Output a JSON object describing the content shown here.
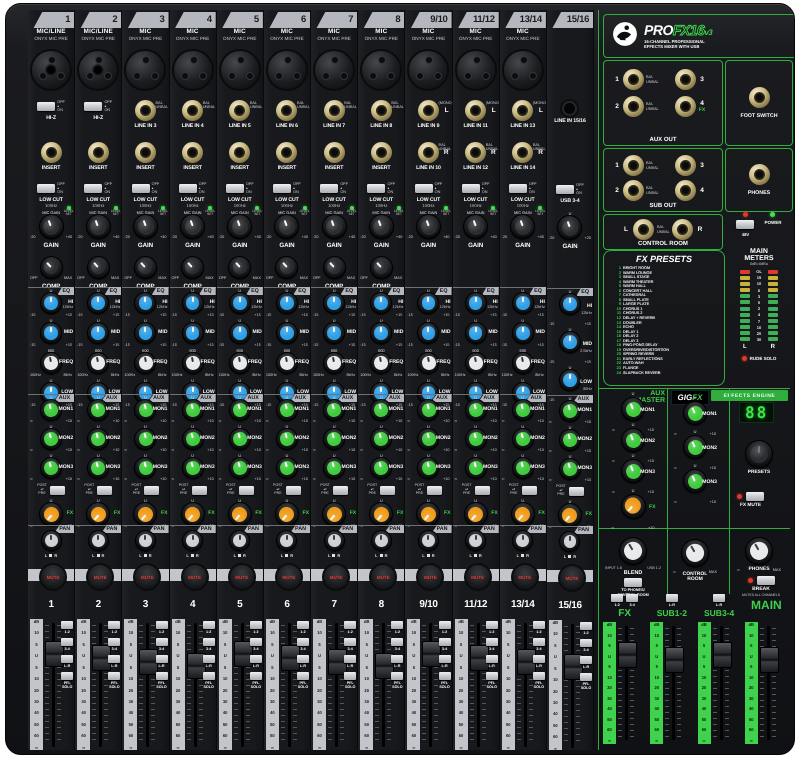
{
  "shared": {
    "u": "U",
    "inf": "∞",
    "plus10": "+10",
    "m15": "-15",
    "p15": "+15",
    "off": "OFF",
    "on": "ON",
    "post": "POST",
    "pre": "PRE",
    "max": "MAX",
    "gain": "GAIN",
    "comp": "COMP",
    "eq": "EQ",
    "aux": "AUX",
    "pan": "PAN",
    "mute": "MUTE",
    "fx": "FX",
    "l": "L",
    "r": "R",
    "mic_gain": "MIC GAIN",
    "level_set": "LEVEL SET",
    "mono": "(MONO)",
    "freq_min": "100Hz",
    "freq_max": "8kHz",
    "freq_center": "600",
    "fader_scale": [
      "dB",
      "10",
      "5",
      "U",
      "5",
      "10",
      "20",
      "30",
      "40",
      "50",
      "60",
      "∞"
    ],
    "fader_btns": [
      "1-2",
      "3-4",
      "L-R",
      "PFL SOLO"
    ],
    "eq_sweep": [
      {
        "n": "HI",
        "s": "12kHz"
      },
      {
        "n": "MID",
        "s": ""
      },
      {
        "n": "FREQ",
        "s": ""
      },
      {
        "n": "LOW",
        "s": "80Hz"
      }
    ],
    "eq_fixed": [
      {
        "n": "HI",
        "s": "12kHz"
      },
      {
        "n": "MID",
        "s": "2.5kHz"
      },
      {
        "n": "LOW",
        "s": "80Hz"
      }
    ],
    "aux_knobs": [
      "MON1",
      "MON2",
      "MON3"
    ]
  },
  "channels": [
    {
      "num": "1",
      "head": "MIC/LINE",
      "sub": "ONYX MIC PRE",
      "input": "combo",
      "rowa": {
        "type": "switch",
        "label": "HI-Z",
        "side": "",
        "tag": ""
      },
      "rowb": {
        "type": "jack",
        "label": "INSERT",
        "side": "",
        "tag": ""
      },
      "sw": {
        "l1": "LOW CUT",
        "l2": "100Hz"
      },
      "gain": {
        "top": "MIC GAIN",
        "min": "-20",
        "max": "+40",
        "led": true
      },
      "comp": true,
      "eq": "sweep"
    },
    {
      "num": "2",
      "head": "MIC/LINE",
      "sub": "ONYX MIC PRE",
      "input": "combo",
      "rowa": {
        "type": "switch",
        "label": "HI-Z",
        "side": "",
        "tag": ""
      },
      "rowb": {
        "type": "jack",
        "label": "INSERT",
        "side": "",
        "tag": ""
      },
      "sw": {
        "l1": "LOW CUT",
        "l2": "100Hz"
      },
      "gain": {
        "top": "MIC GAIN",
        "min": "-20",
        "max": "+40",
        "led": true
      },
      "comp": true,
      "eq": "sweep"
    },
    {
      "num": "3",
      "head": "MIC",
      "sub": "ONYX MIC PRE",
      "input": "xlr",
      "rowa": {
        "type": "jack",
        "label": "LINE IN 3",
        "side": "BAL UNBAL",
        "tag": ""
      },
      "rowb": {
        "type": "jack",
        "label": "INSERT",
        "side": "",
        "tag": ""
      },
      "sw": {
        "l1": "LOW CUT",
        "l2": "100Hz"
      },
      "gain": {
        "top": "MIC GAIN",
        "min": "-20",
        "max": "+40",
        "led": true
      },
      "comp": true,
      "eq": "sweep"
    },
    {
      "num": "4",
      "head": "MIC",
      "sub": "ONYX MIC PRE",
      "input": "xlr",
      "rowa": {
        "type": "jack",
        "label": "LINE IN 4",
        "side": "BAL UNBAL",
        "tag": ""
      },
      "rowb": {
        "type": "jack",
        "label": "INSERT",
        "side": "",
        "tag": ""
      },
      "sw": {
        "l1": "LOW CUT",
        "l2": "100Hz"
      },
      "gain": {
        "top": "MIC GAIN",
        "min": "-20",
        "max": "+40",
        "led": true
      },
      "comp": true,
      "eq": "sweep"
    },
    {
      "num": "5",
      "head": "MIC",
      "sub": "ONYX MIC PRE",
      "input": "xlr",
      "rowa": {
        "type": "jack",
        "label": "LINE IN 5",
        "side": "BAL UNBAL",
        "tag": ""
      },
      "rowb": {
        "type": "jack",
        "label": "INSERT",
        "side": "",
        "tag": ""
      },
      "sw": {
        "l1": "LOW CUT",
        "l2": "100Hz"
      },
      "gain": {
        "top": "MIC GAIN",
        "min": "-20",
        "max": "+40",
        "led": true
      },
      "comp": true,
      "eq": "sweep"
    },
    {
      "num": "6",
      "head": "MIC",
      "sub": "ONYX MIC PRE",
      "input": "xlr",
      "rowa": {
        "type": "jack",
        "label": "LINE IN 6",
        "side": "BAL UNBAL",
        "tag": ""
      },
      "rowb": {
        "type": "jack",
        "label": "INSERT",
        "side": "",
        "tag": ""
      },
      "sw": {
        "l1": "LOW CUT",
        "l2": "100Hz"
      },
      "gain": {
        "top": "MIC GAIN",
        "min": "-20",
        "max": "+40",
        "led": true
      },
      "comp": true,
      "eq": "sweep"
    },
    {
      "num": "7",
      "head": "MIC",
      "sub": "ONYX MIC PRE",
      "input": "xlr",
      "rowa": {
        "type": "jack",
        "label": "LINE IN 7",
        "side": "BAL UNBAL",
        "tag": ""
      },
      "rowb": {
        "type": "jack",
        "label": "INSERT",
        "side": "",
        "tag": ""
      },
      "sw": {
        "l1": "LOW CUT",
        "l2": "100Hz"
      },
      "gain": {
        "top": "MIC GAIN",
        "min": "-20",
        "max": "+40",
        "led": true
      },
      "comp": true,
      "eq": "sweep"
    },
    {
      "num": "8",
      "head": "MIC",
      "sub": "ONYX MIC PRE",
      "input": "xlr",
      "rowa": {
        "type": "jack",
        "label": "LINE IN 8",
        "side": "BAL UNBAL",
        "tag": ""
      },
      "rowb": {
        "type": "jack",
        "label": "INSERT",
        "side": "",
        "tag": ""
      },
      "sw": {
        "l1": "LOW CUT",
        "l2": "100Hz"
      },
      "gain": {
        "top": "MIC GAIN",
        "min": "-20",
        "max": "+40",
        "led": true
      },
      "comp": true,
      "eq": "sweep"
    },
    {
      "num": "9/10",
      "head": "MIC",
      "sub": "ONYX MIC PRE",
      "input": "xlr",
      "rowa": {
        "type": "jack",
        "label": "LINE IN 9",
        "side": "(MONO)",
        "tag": "L"
      },
      "rowb": {
        "type": "jack",
        "label": "LINE IN 10",
        "side": "BAL UNBAL",
        "tag": "R"
      },
      "sw": {
        "l1": "LOW CUT",
        "l2": "100Hz"
      },
      "gain": {
        "top": "MIC GAIN",
        "min": "-20",
        "max": "+40",
        "led": true
      },
      "comp": false,
      "eq": "sweep"
    },
    {
      "num": "11/12",
      "head": "MIC",
      "sub": "ONYX MIC PRE",
      "input": "xlr",
      "rowa": {
        "type": "jack",
        "label": "LINE IN 11",
        "side": "(MONO)",
        "tag": "L"
      },
      "rowb": {
        "type": "jack",
        "label": "LINE IN 12",
        "side": "BAL UNBAL",
        "tag": "R"
      },
      "sw": {
        "l1": "LOW CUT",
        "l2": "100Hz"
      },
      "gain": {
        "top": "MIC GAIN",
        "min": "-20",
        "max": "+40",
        "led": true
      },
      "comp": false,
      "eq": "sweep"
    },
    {
      "num": "13/14",
      "head": "MIC",
      "sub": "ONYX MIC PRE",
      "input": "xlr",
      "rowa": {
        "type": "jack",
        "label": "LINE IN 13",
        "side": "(MONO)",
        "tag": "L"
      },
      "rowb": {
        "type": "jack",
        "label": "LINE IN 14",
        "side": "BAL UNBAL",
        "tag": "R"
      },
      "sw": {
        "l1": "LOW CUT",
        "l2": "100Hz"
      },
      "gain": {
        "top": "MIC GAIN",
        "min": "-20",
        "max": "+40",
        "led": true
      },
      "comp": false,
      "eq": "sweep"
    },
    {
      "num": "15/16",
      "head": "",
      "sub": "",
      "input": "none",
      "rowa": {
        "type": "mini",
        "label": "LINE IN 15/16",
        "side": "",
        "tag": ""
      },
      "rowb": {
        "type": "none",
        "label": "",
        "side": "",
        "tag": ""
      },
      "sw": {
        "l1": "USB 3-4",
        "l2": ""
      },
      "gain": {
        "top": "U",
        "min": "-20",
        "max": "+20",
        "led": false
      },
      "comp": false,
      "eq": "fixed"
    }
  ],
  "master": {
    "brand": {
      "pro": "Pro",
      "fx": "FX16",
      "ver": "v3",
      "tag1": "16-CHANNEL PROFESSIONAL",
      "tag2": "EFFECTS MIXER WITH USB"
    },
    "aux_out": {
      "title": "AUX OUT",
      "n1": "1",
      "n2": "2",
      "n3": "3",
      "n4": "4",
      "fx": "FX",
      "bal": "BAL UNBAL"
    },
    "foot": "FOOT SWITCH",
    "sub_out": {
      "title": "SUB OUT",
      "n1": "1",
      "n2": "2",
      "n3": "3",
      "n4": "4",
      "bal": "BAL UNBAL"
    },
    "phones_jack": "PHONES",
    "c_room": {
      "title": "CONTROL ROOM",
      "l": "L",
      "r": "R",
      "bal": "BAL UNBAL"
    },
    "power": {
      "v48": "48V",
      "power": "POWER"
    },
    "meters": {
      "t1": "MAIN",
      "t2": "METERS",
      "t3": "0dB=0dBu",
      "scale": [
        "OL",
        "15",
        "10",
        "6",
        "3",
        "0",
        "2",
        "4",
        "7",
        "10",
        "20",
        "30"
      ],
      "l": "L",
      "r": "R",
      "rude": "RUDE SOLO"
    },
    "presets": {
      "title": "FX PRESETS",
      "items": [
        {
          "n": "1",
          "t": "BRIGHT ROOM"
        },
        {
          "n": "2",
          "t": "WARM LOUNGE"
        },
        {
          "n": "3",
          "t": "SMALL STAGE"
        },
        {
          "n": "4",
          "t": "WARM THEATER"
        },
        {
          "n": "5",
          "t": "WARM HALL"
        },
        {
          "n": "6",
          "t": "CONCERT HALL"
        },
        {
          "n": "7",
          "t": "CATHEDRAL"
        },
        {
          "n": "8",
          "t": "SMALL PLATE"
        },
        {
          "n": "9",
          "t": "LARGE PLATE"
        },
        {
          "n": "10",
          "t": "CHORUS 1"
        },
        {
          "n": "11",
          "t": "CHORUS 2"
        },
        {
          "n": "12",
          "t": "DELAY + REVERB"
        },
        {
          "n": "13",
          "t": "DOUBLER"
        },
        {
          "n": "14",
          "t": "ECHO"
        },
        {
          "n": "15",
          "t": "DELAY 1"
        },
        {
          "n": "16",
          "t": "DELAY 2"
        },
        {
          "n": "17",
          "t": "DELAY 3"
        },
        {
          "n": "18",
          "t": "PING-PONG DELAY"
        },
        {
          "n": "19",
          "t": "OVERDRIVE/DISTORTION"
        },
        {
          "n": "20",
          "t": "SPRING REVERB"
        },
        {
          "n": "21",
          "t": "EARLY REFLECTIONS"
        },
        {
          "n": "22",
          "t": "AUTO-WAH"
        },
        {
          "n": "23",
          "t": "FLANGE"
        },
        {
          "n": "24",
          "t": "SLAPBACK REVERB"
        }
      ]
    },
    "aux_master": {
      "t1": "AUX",
      "t2": "MASTER"
    },
    "gigfx": {
      "g": "GIG",
      "f": "FX",
      "engine": "EFFECTS ENGINE",
      "display": "88",
      "presets": "PRESETS",
      "fx_mute": "FX MUTE"
    },
    "blend": {
      "l1": "INPUT 1-8",
      "l2": "USB 1-2",
      "label": "BLEND",
      "sw1": "TO PHONES/",
      "sw2": "CONTROL ROOM"
    },
    "cr_knob": {
      "min": "∞",
      "max": "MAX",
      "t1": "CONTROL",
      "t2": "ROOM"
    },
    "ph_knob": {
      "min": "∞",
      "max": "MAX",
      "t": "PHONES",
      "b1": "BREAK",
      "b2": "MUTES ALL CHANNELS"
    },
    "m_faders": [
      {
        "label": "FX",
        "btns": [
          "1-2",
          "3-4"
        ]
      },
      {
        "label": "SUB1-2",
        "btns": [
          "L-R"
        ]
      },
      {
        "label": "SUB3-4",
        "btns": [
          "L-R"
        ]
      },
      {
        "label": "MAIN",
        "btns": []
      }
    ]
  }
}
